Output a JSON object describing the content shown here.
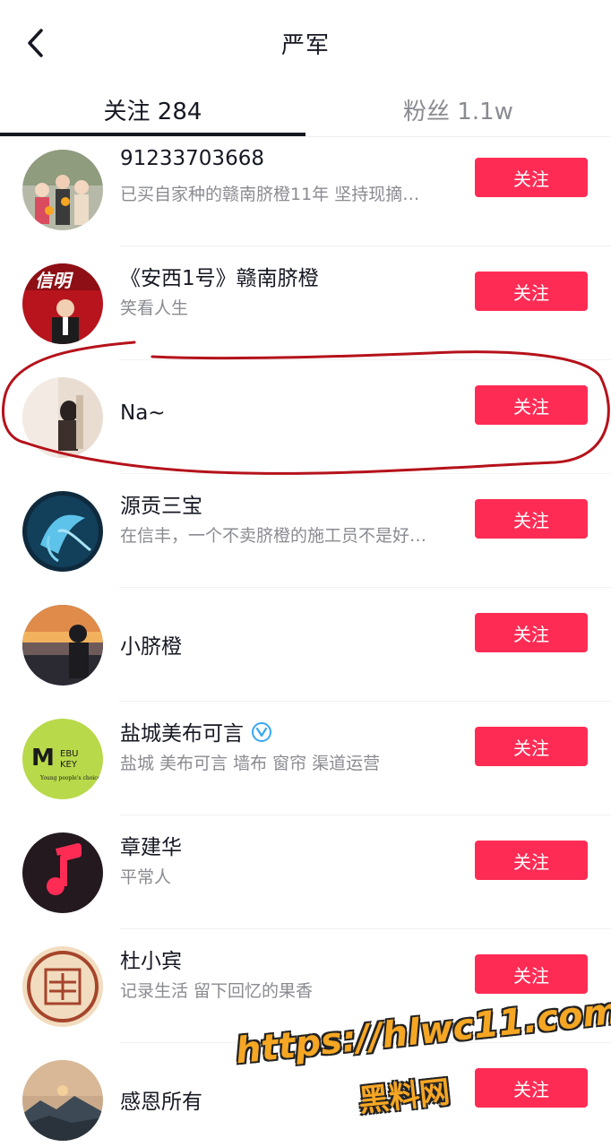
{
  "header": {
    "title": "严军"
  },
  "tabs": [
    {
      "label": "关注 284",
      "active": true
    },
    {
      "label": "粉丝 1.1w",
      "active": false
    }
  ],
  "follow_label": "关注",
  "users": [
    {
      "name": "91233703668",
      "subtitle": "已买自家种的赣南脐橙11年 坚持现摘…"
    },
    {
      "name": "《安西1号》赣南脐橙",
      "subtitle": "笑看人生"
    },
    {
      "name": "Na~",
      "subtitle": ""
    },
    {
      "name": "源贡三宝",
      "subtitle": "在信丰，一个不卖脐橙的施工员不是好…"
    },
    {
      "name": "小脐橙",
      "subtitle": ""
    },
    {
      "name": "盐城美布可言",
      "subtitle": "盐城 美布可言 墙布 窗帘 渠道运营",
      "verified": true
    },
    {
      "name": "章建华",
      "subtitle": "平常人"
    },
    {
      "name": "杜小宾",
      "subtitle": "记录生活 留下回忆的果香"
    },
    {
      "name": "感恩所有",
      "subtitle": ""
    }
  ],
  "watermark": {
    "line1": "https://hlwc11.com",
    "line2": "黑料网"
  },
  "colors": {
    "accent": "#fe2c55",
    "annotation": "#b5121b",
    "watermark": "#f5a623"
  }
}
